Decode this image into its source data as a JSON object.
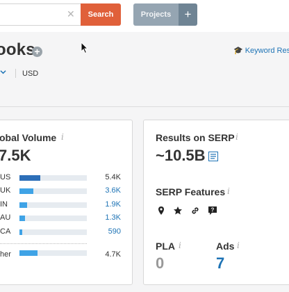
{
  "search": {
    "placeholder": "",
    "button_label": "Search",
    "clear_icon": "close-icon"
  },
  "projects": {
    "label": "Projects",
    "plus_label": "+"
  },
  "page": {
    "title": "ooks",
    "add_icon": "plus-circle-icon"
  },
  "keyword_link": {
    "label": "Keyword Res",
    "icon": "graduation-cap-icon"
  },
  "database": {
    "chevron_icon": "chevron-down-icon",
    "currency": "USD"
  },
  "global_volume": {
    "label": "obal Volume",
    "info": "i",
    "value": "7.5K",
    "rows": [
      {
        "code": "US",
        "value": "5.4K",
        "fraction": 0.31,
        "dark": true,
        "link": false
      },
      {
        "code": "UK",
        "value": "3.6K",
        "fraction": 0.21,
        "dark": false,
        "link": true
      },
      {
        "code": "IN",
        "value": "1.9K",
        "fraction": 0.11,
        "dark": false,
        "link": true
      },
      {
        "code": "AU",
        "value": "1.3K",
        "fraction": 0.08,
        "dark": false,
        "link": true
      },
      {
        "code": "CA",
        "value": "590",
        "fraction": 0.04,
        "dark": false,
        "link": true
      }
    ],
    "other": {
      "code": "her",
      "value": "4.7K",
      "fraction": 0.27
    }
  },
  "serp": {
    "results_label": "Results on SERP",
    "results_info": "i",
    "results_value": "~10.5B",
    "results_icon": "serp-list-icon",
    "features_label": "SERP Features",
    "features_info": "i",
    "features_icons": [
      "map-pin-icon",
      "star-icon",
      "link-icon",
      "question-icon"
    ],
    "pla_label": "PLA",
    "pla_info": "i",
    "pla_value": "0",
    "ads_label": "Ads",
    "ads_info": "i",
    "ads_value": "7"
  },
  "colors": {
    "accent": "#e0603a",
    "link": "#1d73b5",
    "bar": "#3fa3e6",
    "bar_dark": "#2d6fb8"
  }
}
